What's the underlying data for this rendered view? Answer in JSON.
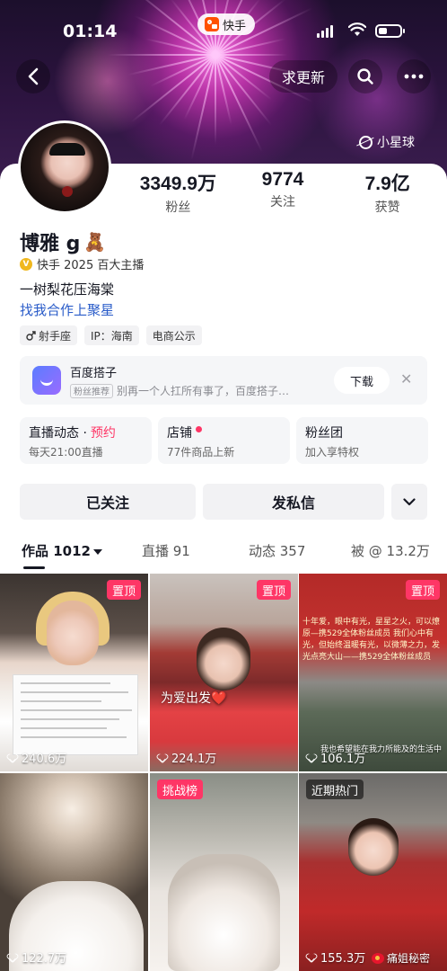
{
  "status_bar": {
    "time": "01:14",
    "app_chip": "快手"
  },
  "header": {
    "update_label": "求更新",
    "planet_label": "小星球"
  },
  "profile": {
    "stats": [
      {
        "value": "3349.9万",
        "label": "粉丝"
      },
      {
        "value": "9774",
        "label": "关注"
      },
      {
        "value": "7.9亿",
        "label": "获赞"
      }
    ],
    "name": "博雅 g",
    "name_emoji": "🧸",
    "verified_label": "快手 2025 百大主播",
    "bio": "一树梨花压海棠",
    "link": "找我合作上聚星",
    "tags": [
      {
        "icon": "male-icon",
        "label": "射手座"
      },
      {
        "label": "IP：海南"
      },
      {
        "label": "电商公示"
      }
    ]
  },
  "ad": {
    "title": "百度搭子",
    "badge": "粉丝推荐",
    "description": "别再一个人扛所有事了，百度搭子…",
    "button": "下载",
    "close": "✕"
  },
  "features": [
    {
      "title": "直播动态 ·",
      "accent": "预约",
      "subtitle": "每天21:00直播"
    },
    {
      "title": "店铺",
      "subtitle": "77件商品上新"
    },
    {
      "title": "粉丝团",
      "subtitle": "加入享特权"
    }
  ],
  "actions": {
    "follow": "已关注",
    "message": "发私信"
  },
  "tabs": [
    {
      "label": "作品 1012"
    },
    {
      "label": "直播 91"
    },
    {
      "label": "动态 357"
    },
    {
      "label": "被 @ 13.2万"
    }
  ],
  "videos": [
    {
      "badge": "置顶",
      "likes": "240.6万"
    },
    {
      "badge": "置顶",
      "likes": "224.1万",
      "caption": "为爱出发❤️"
    },
    {
      "badge": "置顶",
      "likes": "106.1万",
      "banner_text": "十年爱，眼中有光，星星之火，可以燎原—携529全体粉丝成员 我们心中有光，但始终温暖有光，以微薄之力，发光点亮大山——携529全体粉丝成员",
      "caption": "我也希望能在我力所能及的生活中"
    },
    {
      "likes": "122.7万"
    },
    {
      "badge": "挑战榜",
      "likes": null
    },
    {
      "badge": "近期热门",
      "likes": "155.3万"
    }
  ],
  "watermark": "痛姐秘密",
  "colors": {
    "accent": "#fe3666",
    "link": "#2a5cc9",
    "verified": "#f0b81e",
    "brand": "#ff5000"
  }
}
